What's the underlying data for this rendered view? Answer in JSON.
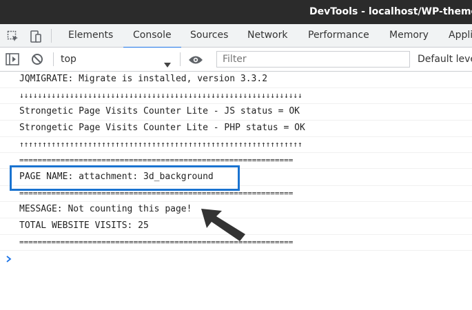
{
  "window": {
    "title": "DevTools - localhost/WP-themes/"
  },
  "tabs": [
    {
      "label": "Elements"
    },
    {
      "label": "Console"
    },
    {
      "label": "Sources"
    },
    {
      "label": "Network"
    },
    {
      "label": "Performance"
    },
    {
      "label": "Memory"
    },
    {
      "label": "Appli"
    }
  ],
  "active_tab": "Console",
  "toolbar": {
    "context": "top",
    "filter_placeholder": "Filter",
    "levels": "Default levels"
  },
  "console": {
    "lines": [
      "JQMIGRATE: Migrate is installed, version 3.3.2",
      "↓↓↓↓↓↓↓↓↓↓↓↓↓↓↓↓↓↓↓↓↓↓↓↓↓↓↓↓↓↓↓↓↓↓↓↓↓↓↓↓↓↓↓↓↓↓↓↓↓↓↓↓↓↓↓↓↓↓↓↓↓↓",
      "Strongetic Page Visits Counter Lite - JS status = OK",
      "Strongetic Page Visits Counter Lite - PHP status = OK",
      "↑↑↑↑↑↑↑↑↑↑↑↑↑↑↑↑↑↑↑↑↑↑↑↑↑↑↑↑↑↑↑↑↑↑↑↑↑↑↑↑↑↑↑↑↑↑↑↑↑↑↑↑↑↑↑↑↑↑↑↑↑↑",
      "============================================================",
      "PAGE NAME: attachment: 3d_background",
      "============================================================",
      "MESSAGE: Not counting this page!",
      "TOTAL WEBSITE VISITS: 25",
      "============================================================"
    ]
  },
  "colors": {
    "titlebar": "#2b2b2b",
    "accent": "#1a73e8",
    "highlight_box": "#1a73d0",
    "arrow": "#333333"
  },
  "icons": {
    "inspect": "inspect-element-icon",
    "device": "device-toolbar-icon",
    "sidebar": "show-sidebar-icon",
    "clear": "clear-console-icon",
    "eye": "live-expression-icon",
    "prompt": "console-prompt-icon"
  }
}
